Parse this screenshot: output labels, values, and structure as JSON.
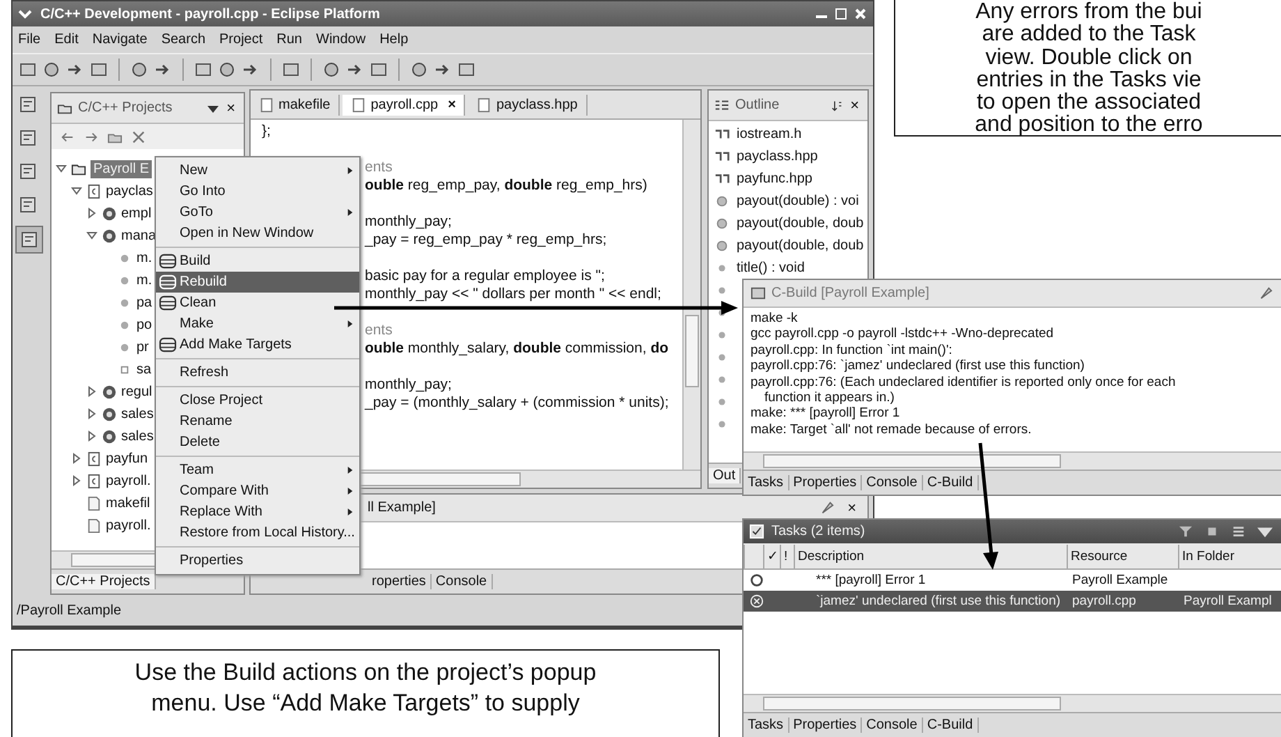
{
  "main_window": {
    "title": "C/C++ Development - payroll.cpp - Eclipse Platform",
    "menu_bar": [
      "File",
      "Edit",
      "Navigate",
      "Search",
      "Project",
      "Run",
      "Window",
      "Help"
    ],
    "projects_view": {
      "title": "C/C++ Projects",
      "close": "×",
      "tree": [
        {
          "label": "Payroll E",
          "kind": "project",
          "expanded": true,
          "selected": true,
          "children": [
            {
              "label": "payclas",
              "kind": "source",
              "expanded": true,
              "selected": false,
              "children": [
                {
                  "label": "empl",
                  "kind": "class",
                  "expanded": false,
                  "selected": false
                },
                {
                  "label": "mana",
                  "kind": "class",
                  "expanded": true,
                  "selected": false,
                  "children": [
                    {
                      "label": "m.",
                      "kind": "method",
                      "selected": false
                    },
                    {
                      "label": "m.",
                      "kind": "method",
                      "selected": false
                    },
                    {
                      "label": "pa",
                      "kind": "method",
                      "selected": false
                    },
                    {
                      "label": "po",
                      "kind": "method",
                      "selected": false
                    },
                    {
                      "label": "pr",
                      "kind": "method",
                      "selected": false
                    },
                    {
                      "label": "sa",
                      "kind": "field",
                      "selected": false
                    }
                  ]
                },
                {
                  "label": "regul",
                  "kind": "class",
                  "expanded": false,
                  "selected": false
                },
                {
                  "label": "sales",
                  "kind": "class",
                  "expanded": false,
                  "selected": false
                },
                {
                  "label": "sales",
                  "kind": "class",
                  "expanded": false,
                  "selected": false
                }
              ]
            },
            {
              "label": "payfun",
              "kind": "source",
              "expanded": false,
              "selected": false
            },
            {
              "label": "payroll.",
              "kind": "source",
              "expanded": false,
              "selected": false
            },
            {
              "label": "makefil",
              "kind": "file",
              "selected": false
            },
            {
              "label": "payroll.",
              "kind": "file",
              "selected": false
            }
          ]
        }
      ],
      "tab": "C/C++ Projects"
    },
    "editor": {
      "tabs": [
        {
          "label": "makefile",
          "selected": false
        },
        {
          "label": "payroll.cpp",
          "selected": true,
          "close": "×"
        },
        {
          "label": "payclass.hpp",
          "selected": false
        }
      ],
      "top_line": "};",
      "blocks": [
        [
          {
            "text": "ents",
            "kind": "comment",
            "clipped": true
          },
          {
            "text": "**ouble** reg_emp_pay, **double** reg_emp_hrs)",
            "kind": "code",
            "clipped": true
          }
        ],
        [
          {
            "text": "monthly_pay;",
            "kind": "code",
            "clipped": true
          },
          {
            "text": "_pay = reg_emp_pay * reg_emp_hrs;",
            "kind": "code",
            "clipped": true
          }
        ],
        [
          {
            "text": "basic pay for a regular employee is \";",
            "kind": "code",
            "clipped": true
          },
          {
            "text": "monthly_pay << \" dollars per month \" << endl;",
            "kind": "code",
            "clipped": true
          }
        ],
        [
          {
            "text": "ents",
            "kind": "comment",
            "clipped": true
          },
          {
            "text": "**ouble** monthly_salary, **double** commission, **do**",
            "kind": "code",
            "clipped": true
          }
        ],
        [
          {
            "text": "monthly_pay;",
            "kind": "code",
            "clipped": true
          },
          {
            "text": "_pay = (monthly_salary + (commission * units);",
            "kind": "code",
            "clipped": true
          }
        ]
      ]
    },
    "outline": {
      "title": "Outline",
      "close": "×",
      "items": [
        {
          "label": "iostream.h",
          "kind": "include"
        },
        {
          "label": "payclass.hpp",
          "kind": "include"
        },
        {
          "label": "payfunc.hpp",
          "kind": "include"
        },
        {
          "label": "payout(double) : voi",
          "kind": "function"
        },
        {
          "label": "payout(double, doub",
          "kind": "function"
        },
        {
          "label": "payout(double, doub",
          "kind": "function"
        },
        {
          "label": "title() : void",
          "kind": "method"
        }
      ],
      "tab": "Out"
    },
    "bottom_panel": {
      "title": "ll Example]",
      "close": "×",
      "tabs": [
        "roperties",
        "Console"
      ]
    },
    "status_bar": "/Payroll Example"
  },
  "context_menu": {
    "groups": [
      [
        {
          "label": "New",
          "kind": "submenu",
          "selected": false
        },
        {
          "label": "Go Into",
          "kind": "plain",
          "selected": false
        },
        {
          "label": "GoTo",
          "kind": "submenu",
          "selected": false
        },
        {
          "label": "Open in New Window",
          "kind": "plain",
          "selected": false
        }
      ],
      [
        {
          "label": "Build",
          "kind": "build",
          "selected": false
        },
        {
          "label": "Rebuild",
          "kind": "build",
          "selected": true
        },
        {
          "label": "Clean",
          "kind": "build",
          "selected": false
        },
        {
          "label": "Make",
          "kind": "submenu",
          "selected": false
        },
        {
          "label": "Add Make Targets",
          "kind": "build",
          "selected": false
        }
      ],
      [
        {
          "label": "Refresh",
          "kind": "plain",
          "selected": false
        }
      ],
      [
        {
          "label": "Close Project",
          "kind": "plain",
          "selected": false
        },
        {
          "label": "Rename",
          "kind": "plain",
          "selected": false
        },
        {
          "label": "Delete",
          "kind": "plain",
          "selected": false
        }
      ],
      [
        {
          "label": "Team",
          "kind": "submenu",
          "selected": false
        },
        {
          "label": "Compare With",
          "kind": "submenu",
          "selected": false
        },
        {
          "label": "Replace With",
          "kind": "submenu",
          "selected": false
        },
        {
          "label": "Restore from Local History...",
          "kind": "plain",
          "selected": false
        }
      ],
      [
        {
          "label": "Properties",
          "kind": "plain",
          "selected": false
        }
      ]
    ]
  },
  "build_console": {
    "title": "C-Build [Payroll Example]",
    "lines": [
      {
        "text": "make -k",
        "kind": "line"
      },
      {
        "text": "gcc payroll.cpp -o payroll  -lstdc++  -Wno-deprecated",
        "kind": "line"
      },
      {
        "text": "payroll.cpp: In function `int main()':",
        "kind": "line"
      },
      {
        "text": "payroll.cpp:76: `jamez' undeclared (first use this function)",
        "kind": "line"
      },
      {
        "text": "payroll.cpp:76: (Each undeclared identifier is reported only once for each",
        "kind": "line"
      },
      {
        "text": "function it appears in.)",
        "kind": "continuation"
      },
      {
        "text": "make: *** [payroll] Error 1",
        "kind": "line"
      },
      {
        "text": "make: Target `all' not remade because of errors.",
        "kind": "line"
      }
    ],
    "tabs": [
      "Tasks",
      "Properties",
      "Console",
      "C-Build"
    ]
  },
  "tasks_view": {
    "title": "Tasks (2 items)",
    "columns": [
      "✓",
      "!",
      "Description",
      "Resource",
      "In Folder"
    ],
    "rows": [
      {
        "kind": "warning",
        "description": "*** [payroll] Error 1",
        "resource": "Payroll Example",
        "selected": false
      },
      {
        "kind": "error",
        "description": "`jamez' undeclared (first use this function)",
        "resource": "payroll.cpp",
        "folder": "Payroll Exampl",
        "selected": true
      }
    ],
    "tabs": [
      "Tasks",
      "Properties",
      "Console",
      "C-Build"
    ]
  },
  "callouts": [
    {
      "lines": [
        "Any errors from the bui",
        "are added to the Task",
        "view.  Double click on",
        "entries in the Tasks vie",
        "to open the associated",
        "and position to the erro"
      ]
    },
    {
      "lines": [
        "Use the Build actions on the project’s popup",
        "menu.  Use “Add Make Targets” to supply"
      ]
    }
  ]
}
